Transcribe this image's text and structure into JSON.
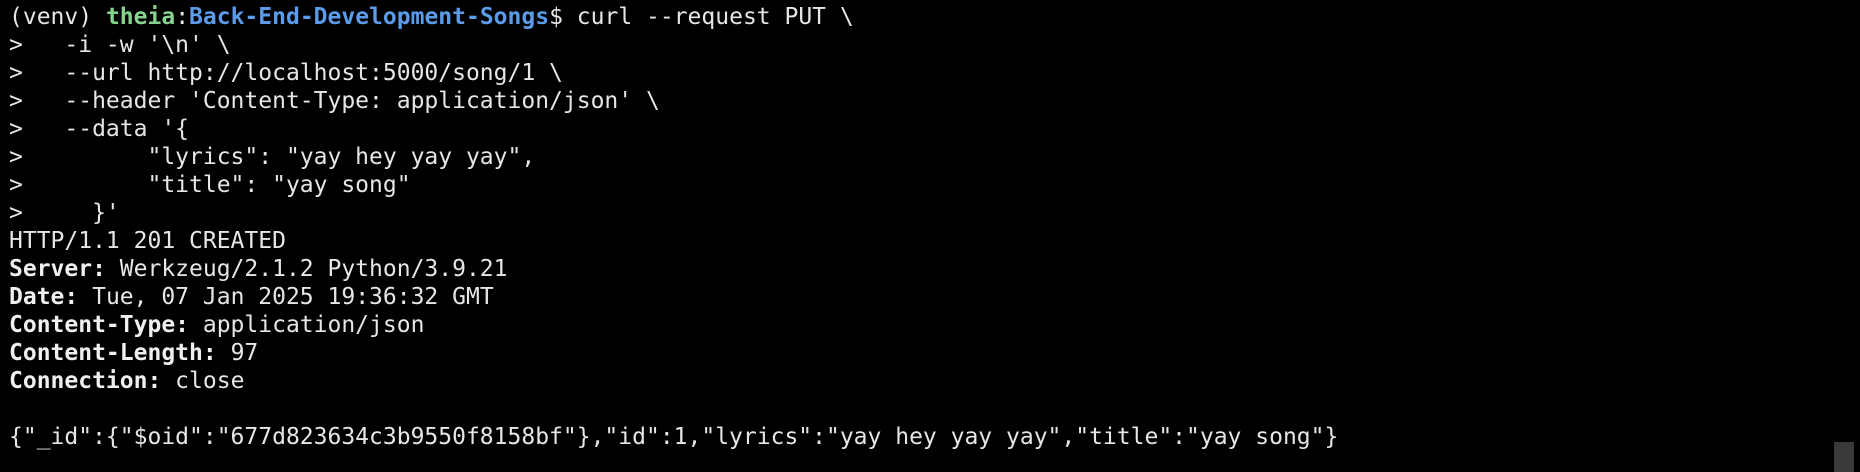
{
  "terminal": {
    "prompt": {
      "venv": "(venv) ",
      "user": "theia",
      "separator": ":",
      "path": "Back-End-Development-Songs",
      "symbol": "$ ",
      "command": "curl --request PUT \\"
    },
    "continuation_lines": [
      ">   -i -w '\\n' \\",
      ">   --url http://localhost:5000/song/1 \\",
      ">   --header 'Content-Type: application/json' \\",
      ">   --data '{",
      ">         \"lyrics\": \"yay hey yay yay\",",
      ">         \"title\": \"yay song\"",
      ">     }'"
    ],
    "status_line": "HTTP/1.1 201 CREATED",
    "headers": [
      {
        "name": "Server:",
        "value": " Werkzeug/2.1.2 Python/3.9.21"
      },
      {
        "name": "Date:",
        "value": " Tue, 07 Jan 2025 19:36:32 GMT"
      },
      {
        "name": "Content-Type:",
        "value": " application/json"
      },
      {
        "name": "Content-Length:",
        "value": " 97"
      },
      {
        "name": "Connection:",
        "value": " close"
      }
    ],
    "response_body": "{\"_id\":{\"$oid\":\"677d823634c3b9550f8158bf\"},\"id\":1,\"lyrics\":\"yay hey yay yay\",\"title\":\"yay song\"}"
  },
  "colors": {
    "background": "#000000",
    "text": "#e6e6e6",
    "user": "#86d28e",
    "path": "#5b9bea"
  }
}
